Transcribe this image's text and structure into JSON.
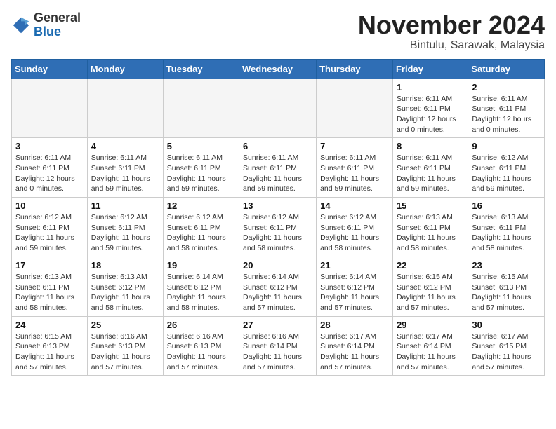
{
  "header": {
    "logo_general": "General",
    "logo_blue": "Blue",
    "month_title": "November 2024",
    "location": "Bintulu, Sarawak, Malaysia"
  },
  "days_of_week": [
    "Sunday",
    "Monday",
    "Tuesday",
    "Wednesday",
    "Thursday",
    "Friday",
    "Saturday"
  ],
  "weeks": [
    [
      {
        "day": "",
        "empty": true
      },
      {
        "day": "",
        "empty": true
      },
      {
        "day": "",
        "empty": true
      },
      {
        "day": "",
        "empty": true
      },
      {
        "day": "",
        "empty": true
      },
      {
        "day": "1",
        "sunrise": "6:11 AM",
        "sunset": "6:11 PM",
        "daylight": "12 hours and 0 minutes."
      },
      {
        "day": "2",
        "sunrise": "6:11 AM",
        "sunset": "6:11 PM",
        "daylight": "12 hours and 0 minutes."
      }
    ],
    [
      {
        "day": "3",
        "sunrise": "6:11 AM",
        "sunset": "6:11 PM",
        "daylight": "12 hours and 0 minutes."
      },
      {
        "day": "4",
        "sunrise": "6:11 AM",
        "sunset": "6:11 PM",
        "daylight": "11 hours and 59 minutes."
      },
      {
        "day": "5",
        "sunrise": "6:11 AM",
        "sunset": "6:11 PM",
        "daylight": "11 hours and 59 minutes."
      },
      {
        "day": "6",
        "sunrise": "6:11 AM",
        "sunset": "6:11 PM",
        "daylight": "11 hours and 59 minutes."
      },
      {
        "day": "7",
        "sunrise": "6:11 AM",
        "sunset": "6:11 PM",
        "daylight": "11 hours and 59 minutes."
      },
      {
        "day": "8",
        "sunrise": "6:11 AM",
        "sunset": "6:11 PM",
        "daylight": "11 hours and 59 minutes."
      },
      {
        "day": "9",
        "sunrise": "6:12 AM",
        "sunset": "6:11 PM",
        "daylight": "11 hours and 59 minutes."
      }
    ],
    [
      {
        "day": "10",
        "sunrise": "6:12 AM",
        "sunset": "6:11 PM",
        "daylight": "11 hours and 59 minutes."
      },
      {
        "day": "11",
        "sunrise": "6:12 AM",
        "sunset": "6:11 PM",
        "daylight": "11 hours and 59 minutes."
      },
      {
        "day": "12",
        "sunrise": "6:12 AM",
        "sunset": "6:11 PM",
        "daylight": "11 hours and 58 minutes."
      },
      {
        "day": "13",
        "sunrise": "6:12 AM",
        "sunset": "6:11 PM",
        "daylight": "11 hours and 58 minutes."
      },
      {
        "day": "14",
        "sunrise": "6:12 AM",
        "sunset": "6:11 PM",
        "daylight": "11 hours and 58 minutes."
      },
      {
        "day": "15",
        "sunrise": "6:13 AM",
        "sunset": "6:11 PM",
        "daylight": "11 hours and 58 minutes."
      },
      {
        "day": "16",
        "sunrise": "6:13 AM",
        "sunset": "6:11 PM",
        "daylight": "11 hours and 58 minutes."
      }
    ],
    [
      {
        "day": "17",
        "sunrise": "6:13 AM",
        "sunset": "6:11 PM",
        "daylight": "11 hours and 58 minutes."
      },
      {
        "day": "18",
        "sunrise": "6:13 AM",
        "sunset": "6:12 PM",
        "daylight": "11 hours and 58 minutes."
      },
      {
        "day": "19",
        "sunrise": "6:14 AM",
        "sunset": "6:12 PM",
        "daylight": "11 hours and 58 minutes."
      },
      {
        "day": "20",
        "sunrise": "6:14 AM",
        "sunset": "6:12 PM",
        "daylight": "11 hours and 57 minutes."
      },
      {
        "day": "21",
        "sunrise": "6:14 AM",
        "sunset": "6:12 PM",
        "daylight": "11 hours and 57 minutes."
      },
      {
        "day": "22",
        "sunrise": "6:15 AM",
        "sunset": "6:12 PM",
        "daylight": "11 hours and 57 minutes."
      },
      {
        "day": "23",
        "sunrise": "6:15 AM",
        "sunset": "6:13 PM",
        "daylight": "11 hours and 57 minutes."
      }
    ],
    [
      {
        "day": "24",
        "sunrise": "6:15 AM",
        "sunset": "6:13 PM",
        "daylight": "11 hours and 57 minutes."
      },
      {
        "day": "25",
        "sunrise": "6:16 AM",
        "sunset": "6:13 PM",
        "daylight": "11 hours and 57 minutes."
      },
      {
        "day": "26",
        "sunrise": "6:16 AM",
        "sunset": "6:13 PM",
        "daylight": "11 hours and 57 minutes."
      },
      {
        "day": "27",
        "sunrise": "6:16 AM",
        "sunset": "6:14 PM",
        "daylight": "11 hours and 57 minutes."
      },
      {
        "day": "28",
        "sunrise": "6:17 AM",
        "sunset": "6:14 PM",
        "daylight": "11 hours and 57 minutes."
      },
      {
        "day": "29",
        "sunrise": "6:17 AM",
        "sunset": "6:14 PM",
        "daylight": "11 hours and 57 minutes."
      },
      {
        "day": "30",
        "sunrise": "6:17 AM",
        "sunset": "6:15 PM",
        "daylight": "11 hours and 57 minutes."
      }
    ]
  ]
}
